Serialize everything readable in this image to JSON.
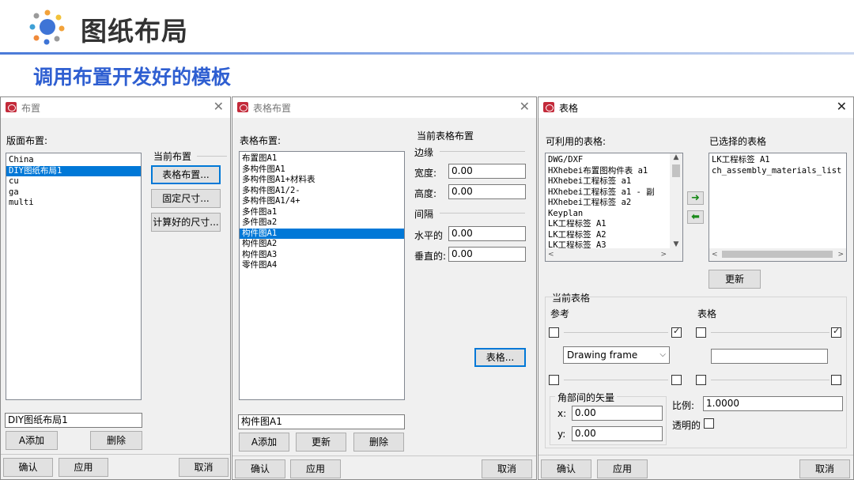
{
  "slide": {
    "title": "图纸布局",
    "subtitle": "调用布置开发好的模板"
  },
  "colors": {
    "accent": "#2f5fd1",
    "selection": "#0078d7",
    "dialog_bg": "#f0f0f0"
  },
  "dlg1": {
    "title": "布置",
    "layout_label": "版面布置:",
    "items": [
      "China",
      "DIY图纸布局1",
      "cu",
      "ga",
      "multi"
    ],
    "selected_index": 1,
    "current_label": "当前布置",
    "btn_table_layout": "表格布置...",
    "btn_fixed_size": "固定尺寸...",
    "btn_calc_size": "计算好的尺寸...",
    "name_value": "DIY图纸布局1",
    "btn_add": "A添加",
    "btn_delete": "删除",
    "btn_ok": "确认",
    "btn_apply": "应用",
    "btn_cancel": "取消"
  },
  "dlg2": {
    "title": "表格布置",
    "layout_label": "表格布置:",
    "items": [
      "布置图A1",
      "多构件图A1",
      "多构件图A1+材料表",
      "多构件图A1/2-",
      "多构件图A1/4+",
      "多件图a1",
      "多件图a2",
      "构件图A1",
      "构件图A2",
      "构件图A3",
      "零件图A4"
    ],
    "selected_index": 7,
    "current_label": "当前表格布置",
    "margin_label": "边缘",
    "width_label": "宽度:",
    "width_value": "0.00",
    "height_label": "高度:",
    "height_value": "0.00",
    "gap_label": "间隔",
    "horiz_label": "水平的",
    "horiz_value": "0.00",
    "vert_label": "垂直的:",
    "vert_value": "0.00",
    "btn_tables": "表格...",
    "name_value": "构件图A1",
    "btn_add": "A添加",
    "btn_update": "更新",
    "btn_delete": "删除",
    "btn_ok": "确认",
    "btn_apply": "应用",
    "btn_cancel": "取消"
  },
  "dlg3": {
    "title": "表格",
    "available_label": "可利用的表格:",
    "available": [
      "DWG/DXF",
      "HXhebei布置图构件表 a1",
      "HXhebei工程标签 a1",
      "HXhebei工程标签 a1 - 副",
      "HXhebei工程标签 a2",
      "Keyplan",
      "LK工程标签 A1",
      "LK工程标签 A2",
      "LK工程标签 A3"
    ],
    "selected_label": "已选择的表格",
    "selected": [
      "LK工程标签 A1",
      "ch_assembly_materials_list"
    ],
    "btn_update": "更新",
    "current_table_label": "当前表格",
    "reference_label": "参考",
    "table_label": "表格",
    "ref_combo_value": "Drawing frame",
    "table_input_value": "",
    "vector_label": "角部间的矢量",
    "x_label": "x:",
    "x_value": "0.00",
    "y_label": "y:",
    "y_value": "0.00",
    "scale_label": "比例:",
    "scale_value": "1.0000",
    "transparent_label": "透明的",
    "btn_ok": "确认",
    "btn_apply": "应用",
    "btn_cancel": "取消"
  }
}
